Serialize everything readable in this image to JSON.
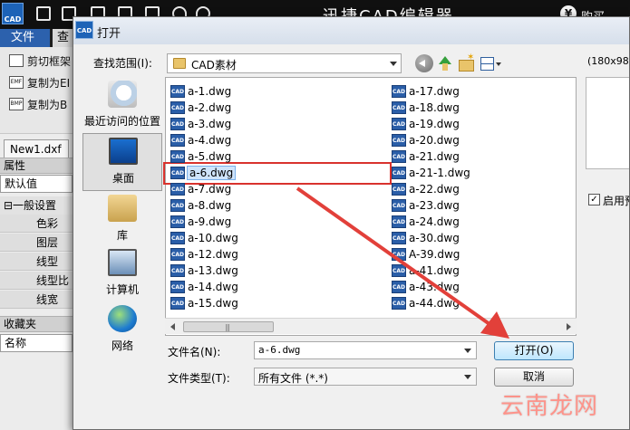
{
  "app": {
    "logo_text": "CAD",
    "title": "迅捷CAD编辑器",
    "buy_label": "购买",
    "tabs": [
      "文件",
      "查"
    ],
    "ribbon": [
      "剪切框架",
      "复制为EI",
      "复制为B"
    ],
    "ribbon_icon_text": [
      "",
      "EMF",
      "BMP"
    ],
    "doc_tab": "New1.dxf",
    "properties_header": "属性",
    "properties_select": "默认值",
    "group_general": "⊟一般设置",
    "props": [
      "色彩",
      "图层",
      "线型",
      "线型比",
      "线宽"
    ],
    "favorites_header": "收藏夹",
    "name_column": "名称"
  },
  "dialog": {
    "icon_text": "CAD",
    "title": "打开",
    "look_in_label": "查找范围(I):",
    "look_in_value": "CAD素材",
    "preview_size": "(180x98)",
    "preview_checkbox_label": "启用预",
    "places": [
      "最近访问的位置",
      "桌面",
      "库",
      "计算机",
      "网络"
    ],
    "file_icon_text": "CAD",
    "files_col1": [
      "a-1.dwg",
      "a-2.dwg",
      "a-3.dwg",
      "a-4.dwg",
      "a-5.dwg",
      "a-6.dwg",
      "a-7.dwg",
      "a-8.dwg",
      "a-9.dwg",
      "a-10.dwg",
      "a-12.dwg",
      "a-13.dwg",
      "a-14.dwg",
      "a-15.dwg"
    ],
    "files_col2": [
      "a-17.dwg",
      "a-18.dwg",
      "a-19.dwg",
      "a-20.dwg",
      "a-21.dwg",
      "a-21-1.dwg",
      "a-22.dwg",
      "a-23.dwg",
      "a-24.dwg",
      "a-30.dwg",
      "A-39.dwg",
      "a-41.dwg",
      "a-43.dwg",
      "a-44.dwg"
    ],
    "selected_file": "a-6.dwg",
    "filename_label": "文件名(N):",
    "filename_value": "a-6.dwg",
    "filetype_label": "文件类型(T):",
    "filetype_value": "所有文件 (*.*)",
    "open_button": "打开(O)",
    "cancel_button": "取消",
    "scroll_grip": "|||"
  },
  "watermark": "云南龙网",
  "colors": {
    "accent_red": "#d9322d",
    "ribbon_blue": "#2c61ad",
    "selection": "#cfe4fb"
  }
}
